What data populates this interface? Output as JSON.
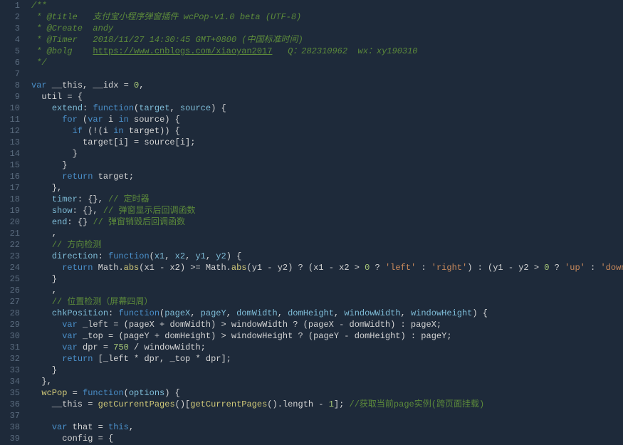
{
  "gutter": {
    "start": 1,
    "end": 39
  },
  "lines": [
    [
      {
        "c": "c-doc",
        "t": "/**"
      }
    ],
    [
      {
        "c": "c-doc",
        "t": " * @title   支付宝小程序弹窗插件 wcPop-v1.0 beta (UTF-8)"
      }
    ],
    [
      {
        "c": "c-doc",
        "t": " * @Create  andy"
      }
    ],
    [
      {
        "c": "c-doc",
        "t": " * @Timer   2018/11/27 14:30:45 GMT+0800 (中国标准时间)"
      }
    ],
    [
      {
        "c": "c-doc",
        "t": " * @bolg    "
      },
      {
        "c": "c-link",
        "t": "https://www.cnblogs.com/xiaoyan2017"
      },
      {
        "c": "c-doc",
        "t": "   Q：282310962  wx：xy190310"
      }
    ],
    [
      {
        "c": "c-doc",
        "t": " */"
      }
    ],
    [
      {
        "c": "",
        "t": ""
      }
    ],
    [
      {
        "c": "c-kw",
        "t": "var"
      },
      {
        "c": "",
        "t": " __this, __idx = "
      },
      {
        "c": "c-num",
        "t": "0"
      },
      {
        "c": "",
        "t": ","
      }
    ],
    [
      {
        "c": "",
        "t": "  util = {"
      }
    ],
    [
      {
        "c": "",
        "t": "    "
      },
      {
        "c": "c-prop",
        "t": "extend"
      },
      {
        "c": "",
        "t": ": "
      },
      {
        "c": "c-kw",
        "t": "function"
      },
      {
        "c": "",
        "t": "("
      },
      {
        "c": "c-var",
        "t": "target"
      },
      {
        "c": "",
        "t": ", "
      },
      {
        "c": "c-var",
        "t": "source"
      },
      {
        "c": "",
        "t": ") {"
      }
    ],
    [
      {
        "c": "",
        "t": "      "
      },
      {
        "c": "c-kw",
        "t": "for"
      },
      {
        "c": "",
        "t": " ("
      },
      {
        "c": "c-kw",
        "t": "var"
      },
      {
        "c": "",
        "t": " i "
      },
      {
        "c": "c-kw",
        "t": "in"
      },
      {
        "c": "",
        "t": " source) {"
      }
    ],
    [
      {
        "c": "",
        "t": "        "
      },
      {
        "c": "c-kw",
        "t": "if"
      },
      {
        "c": "",
        "t": " (!(i "
      },
      {
        "c": "c-kw",
        "t": "in"
      },
      {
        "c": "",
        "t": " target)) {"
      }
    ],
    [
      {
        "c": "",
        "t": "          target[i] = source[i];"
      }
    ],
    [
      {
        "c": "",
        "t": "        }"
      }
    ],
    [
      {
        "c": "",
        "t": "      }"
      }
    ],
    [
      {
        "c": "",
        "t": "      "
      },
      {
        "c": "c-kw",
        "t": "return"
      },
      {
        "c": "",
        "t": " target;"
      }
    ],
    [
      {
        "c": "",
        "t": "    },"
      }
    ],
    [
      {
        "c": "",
        "t": "    "
      },
      {
        "c": "c-prop",
        "t": "timer"
      },
      {
        "c": "",
        "t": ": {}, "
      },
      {
        "c": "c-cmt",
        "t": "// 定时器"
      }
    ],
    [
      {
        "c": "",
        "t": "    "
      },
      {
        "c": "c-prop",
        "t": "show"
      },
      {
        "c": "",
        "t": ": {}, "
      },
      {
        "c": "c-cmt",
        "t": "// 弹窗显示后回调函数"
      }
    ],
    [
      {
        "c": "",
        "t": "    "
      },
      {
        "c": "c-prop",
        "t": "end"
      },
      {
        "c": "",
        "t": ": {} "
      },
      {
        "c": "c-cmt",
        "t": "// 弹窗销毁后回调函数"
      }
    ],
    [
      {
        "c": "",
        "t": "    ,"
      }
    ],
    [
      {
        "c": "",
        "t": "    "
      },
      {
        "c": "c-cmt",
        "t": "// 方向检测"
      }
    ],
    [
      {
        "c": "",
        "t": "    "
      },
      {
        "c": "c-prop",
        "t": "direction"
      },
      {
        "c": "",
        "t": ": "
      },
      {
        "c": "c-kw",
        "t": "function"
      },
      {
        "c": "",
        "t": "("
      },
      {
        "c": "c-var",
        "t": "x1"
      },
      {
        "c": "",
        "t": ", "
      },
      {
        "c": "c-var",
        "t": "x2"
      },
      {
        "c": "",
        "t": ", "
      },
      {
        "c": "c-var",
        "t": "y1"
      },
      {
        "c": "",
        "t": ", "
      },
      {
        "c": "c-var",
        "t": "y2"
      },
      {
        "c": "",
        "t": ") {"
      }
    ],
    [
      {
        "c": "",
        "t": "      "
      },
      {
        "c": "c-kw",
        "t": "return"
      },
      {
        "c": "",
        "t": " Math."
      },
      {
        "c": "c-fn",
        "t": "abs"
      },
      {
        "c": "",
        "t": "(x1 - x2) >= Math."
      },
      {
        "c": "c-fn",
        "t": "abs"
      },
      {
        "c": "",
        "t": "(y1 - y2) ? (x1 - x2 > "
      },
      {
        "c": "c-num",
        "t": "0"
      },
      {
        "c": "",
        "t": " ? "
      },
      {
        "c": "c-str",
        "t": "'left'"
      },
      {
        "c": "",
        "t": " : "
      },
      {
        "c": "c-str",
        "t": "'right'"
      },
      {
        "c": "",
        "t": ") : (y1 - y2 > "
      },
      {
        "c": "c-num",
        "t": "0"
      },
      {
        "c": "",
        "t": " ? "
      },
      {
        "c": "c-str",
        "t": "'up'"
      },
      {
        "c": "",
        "t": " : "
      },
      {
        "c": "c-str",
        "t": "'down'"
      },
      {
        "c": "",
        "t": ")"
      }
    ],
    [
      {
        "c": "",
        "t": "    }"
      }
    ],
    [
      {
        "c": "",
        "t": "    ,"
      }
    ],
    [
      {
        "c": "",
        "t": "    "
      },
      {
        "c": "c-cmt",
        "t": "// 位置检测（屏幕四周）"
      }
    ],
    [
      {
        "c": "",
        "t": "    "
      },
      {
        "c": "c-prop",
        "t": "chkPosition"
      },
      {
        "c": "",
        "t": ": "
      },
      {
        "c": "c-kw",
        "t": "function"
      },
      {
        "c": "",
        "t": "("
      },
      {
        "c": "c-var",
        "t": "pageX"
      },
      {
        "c": "",
        "t": ", "
      },
      {
        "c": "c-var",
        "t": "pageY"
      },
      {
        "c": "",
        "t": ", "
      },
      {
        "c": "c-var",
        "t": "domWidth"
      },
      {
        "c": "",
        "t": ", "
      },
      {
        "c": "c-var",
        "t": "domHeight"
      },
      {
        "c": "",
        "t": ", "
      },
      {
        "c": "c-var",
        "t": "windowWidth"
      },
      {
        "c": "",
        "t": ", "
      },
      {
        "c": "c-var",
        "t": "windowHeight"
      },
      {
        "c": "",
        "t": ") {"
      }
    ],
    [
      {
        "c": "",
        "t": "      "
      },
      {
        "c": "c-kw",
        "t": "var"
      },
      {
        "c": "",
        "t": " _left = (pageX + domWidth) > windowWidth ? (pageX - domWidth) : pageX;"
      }
    ],
    [
      {
        "c": "",
        "t": "      "
      },
      {
        "c": "c-kw",
        "t": "var"
      },
      {
        "c": "",
        "t": " _top = (pageY + domHeight) > windowHeight ? (pageY - domHeight) : pageY;"
      }
    ],
    [
      {
        "c": "",
        "t": "      "
      },
      {
        "c": "c-kw",
        "t": "var"
      },
      {
        "c": "",
        "t": " dpr = "
      },
      {
        "c": "c-num",
        "t": "750"
      },
      {
        "c": "",
        "t": " / windowWidth;"
      }
    ],
    [
      {
        "c": "",
        "t": "      "
      },
      {
        "c": "c-kw",
        "t": "return"
      },
      {
        "c": "",
        "t": " [_left * dpr, _top * dpr];"
      }
    ],
    [
      {
        "c": "",
        "t": "    }"
      }
    ],
    [
      {
        "c": "",
        "t": "  },"
      }
    ],
    [
      {
        "c": "",
        "t": "  "
      },
      {
        "c": "c-fn",
        "t": "wcPop"
      },
      {
        "c": "",
        "t": " = "
      },
      {
        "c": "c-kw",
        "t": "function"
      },
      {
        "c": "",
        "t": "("
      },
      {
        "c": "c-var",
        "t": "options"
      },
      {
        "c": "",
        "t": ") {"
      }
    ],
    [
      {
        "c": "",
        "t": "    __this = "
      },
      {
        "c": "c-fn",
        "t": "getCurrentPages"
      },
      {
        "c": "",
        "t": "()["
      },
      {
        "c": "c-fn",
        "t": "getCurrentPages"
      },
      {
        "c": "",
        "t": "().length - "
      },
      {
        "c": "c-num",
        "t": "1"
      },
      {
        "c": "",
        "t": "]; "
      },
      {
        "c": "c-cmt",
        "t": "//获取当前page实例(跨页面挂载)"
      }
    ],
    [
      {
        "c": "",
        "t": ""
      }
    ],
    [
      {
        "c": "",
        "t": "    "
      },
      {
        "c": "c-kw",
        "t": "var"
      },
      {
        "c": "",
        "t": " that = "
      },
      {
        "c": "c-this",
        "t": "this"
      },
      {
        "c": "",
        "t": ","
      }
    ],
    [
      {
        "c": "",
        "t": "      config = {"
      }
    ]
  ]
}
